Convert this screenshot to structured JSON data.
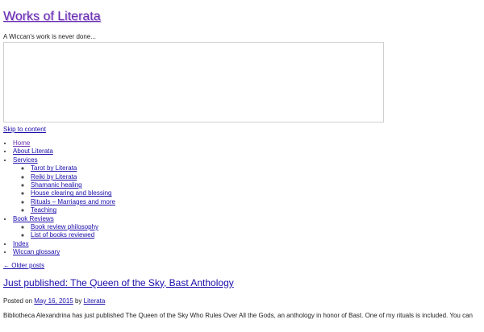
{
  "site": {
    "title": "Works of Literata",
    "tagline": "A Wiccan's work is never done..."
  },
  "skip_link": "Skip to content",
  "nav": {
    "home": "Home",
    "about": "About Literata",
    "services": "Services",
    "services_sub": [
      "Tarot by Literata",
      "Reiki by Literata",
      "Shamanic healing",
      "House clearing and blessing",
      "Rituals – Marriages and more",
      "Teaching"
    ],
    "book_reviews": "Book Reviews",
    "book_reviews_sub": [
      "Book review philosophy",
      "List of books reviewed"
    ],
    "index": "Index",
    "glossary": "Wiccan glossary"
  },
  "older_posts": "← Older posts",
  "post": {
    "title": "Just published: The Queen of the Sky, Bast Anthology",
    "meta_prefix": "Posted on",
    "date": "May 16, 2015",
    "meta_by": "by",
    "author": "Literata",
    "excerpt": "Bibliotheca Alexandrina has just published The Queen of the Sky Who Rules Over All the Gods, an anthology in honor of Bast. One of my rituals is included. You can"
  },
  "colors": {
    "site_title": "#6a2bb0",
    "link": "#1a0dab"
  }
}
